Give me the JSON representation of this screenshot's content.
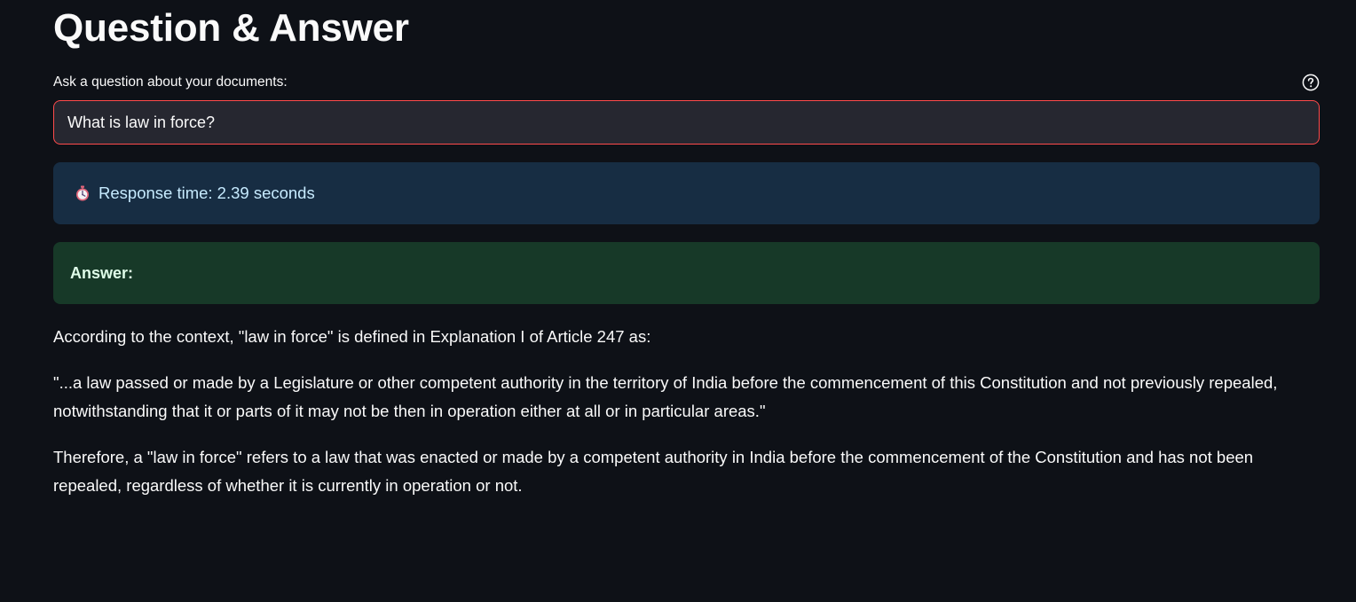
{
  "page": {
    "title": "Question & Answer"
  },
  "question": {
    "label": "Ask a question about your documents:",
    "value": "What is law in force?",
    "help_icon": "question-circle-icon"
  },
  "info": {
    "icon": "stopwatch-icon",
    "text": "Response time: 2.39 seconds"
  },
  "success": {
    "text": "Answer:"
  },
  "answer": {
    "paragraphs": [
      "According to the context, \"law in force\" is defined in Explanation I of Article 247 as:",
      "\"...a law passed or made by a Legislature or other competent authority in the territory of India before the commencement of this Constitution and not previously repealed, notwithstanding that it or parts of it may not be then in operation either at all or in particular areas.\"",
      "Therefore, a \"law in force\" refers to a law that was enacted or made by a competent authority in India before the commencement of the Constitution and has not been repealed, regardless of whether it is currently in operation or not."
    ]
  },
  "colors": {
    "background": "#0e1117",
    "input_border_focus": "#ff4b4b",
    "info_background": "#172d43",
    "success_background": "#173928"
  }
}
